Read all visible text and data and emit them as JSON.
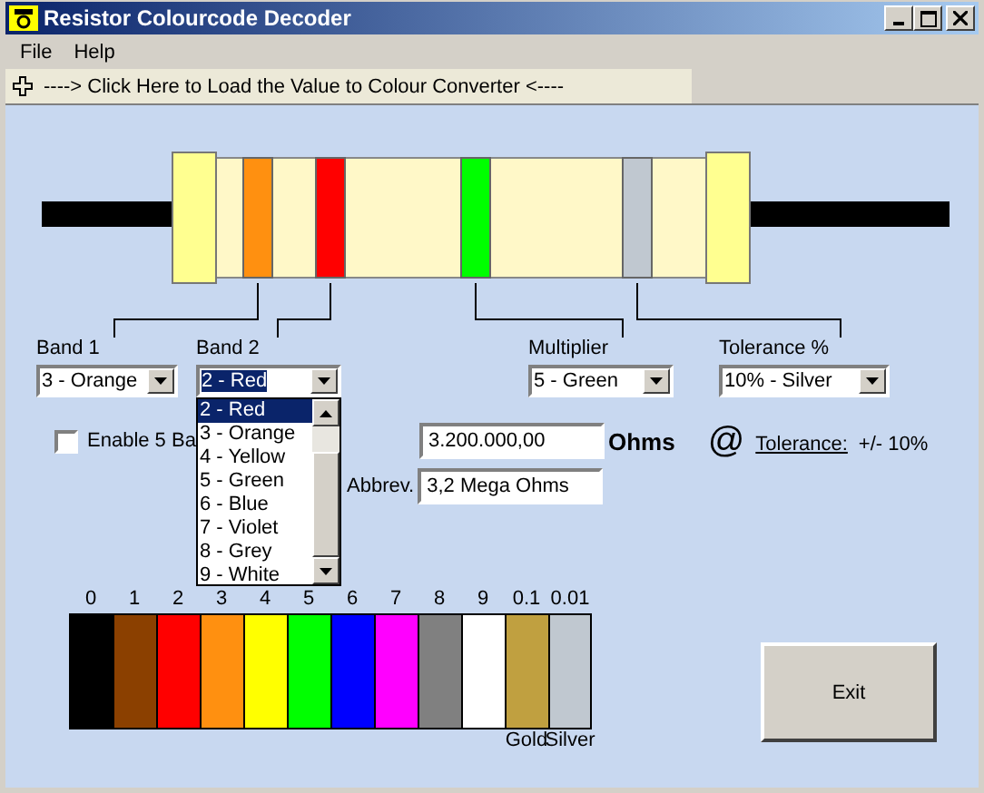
{
  "window": {
    "title": "Resistor Colourcode Decoder"
  },
  "menu": [
    "File",
    "Help"
  ],
  "toolbar": {
    "link": "----> Click Here to Load the Value to Colour Converter <----"
  },
  "resistor": {
    "bands": [
      {
        "color": "#ff9010"
      },
      {
        "color": "#ff0000"
      },
      {
        "color": "#00ff00"
      },
      {
        "color": "#c0c8d0"
      }
    ]
  },
  "selectors": [
    {
      "label": "Band 1",
      "value": "3 - Orange",
      "open": false
    },
    {
      "label": "Band 2",
      "value": "2 - Red",
      "open": true
    },
    {
      "label": "Multiplier",
      "value": "5 - Green",
      "open": false
    },
    {
      "label": "Tolerance %",
      "value": "10% - Silver",
      "open": false
    }
  ],
  "dropdown": {
    "options": [
      {
        "label": "2 - Red",
        "selected": true
      },
      {
        "label": "3 - Orange",
        "selected": false
      },
      {
        "label": "4 - Yellow",
        "selected": false
      },
      {
        "label": "5 - Green",
        "selected": false
      },
      {
        "label": "6 - Blue",
        "selected": false
      },
      {
        "label": "7 - Violet",
        "selected": false
      },
      {
        "label": "8 - Grey",
        "selected": false
      },
      {
        "label": "9 - White",
        "selected": false
      }
    ]
  },
  "five_band": {
    "label": "Enable 5 Ba",
    "checked": false
  },
  "value": "3.200.000,00",
  "unit": "Ohms",
  "at": "@",
  "tolerance_label": "Tolerance:",
  "tolerance_value": "+/- 10%",
  "abbrev_label": "Abbrev.",
  "abbrev": "3,2 Mega Ohms",
  "scale": [
    {
      "label": "0",
      "color": "#000000"
    },
    {
      "label": "1",
      "color": "#8b4000"
    },
    {
      "label": "2",
      "color": "#ff0000"
    },
    {
      "label": "3",
      "color": "#ff9010"
    },
    {
      "label": "4",
      "color": "#ffff00"
    },
    {
      "label": "5",
      "color": "#00ff00"
    },
    {
      "label": "6",
      "color": "#0000ff"
    },
    {
      "label": "7",
      "color": "#ff00ff"
    },
    {
      "label": "8",
      "color": "#808080"
    },
    {
      "label": "9",
      "color": "#ffffff"
    },
    {
      "label": "0.1",
      "color": "#c0a040",
      "name": "Gold"
    },
    {
      "label": "0.01",
      "color": "#c0c8d0",
      "name": "Silver"
    }
  ],
  "exit_button": "Exit"
}
